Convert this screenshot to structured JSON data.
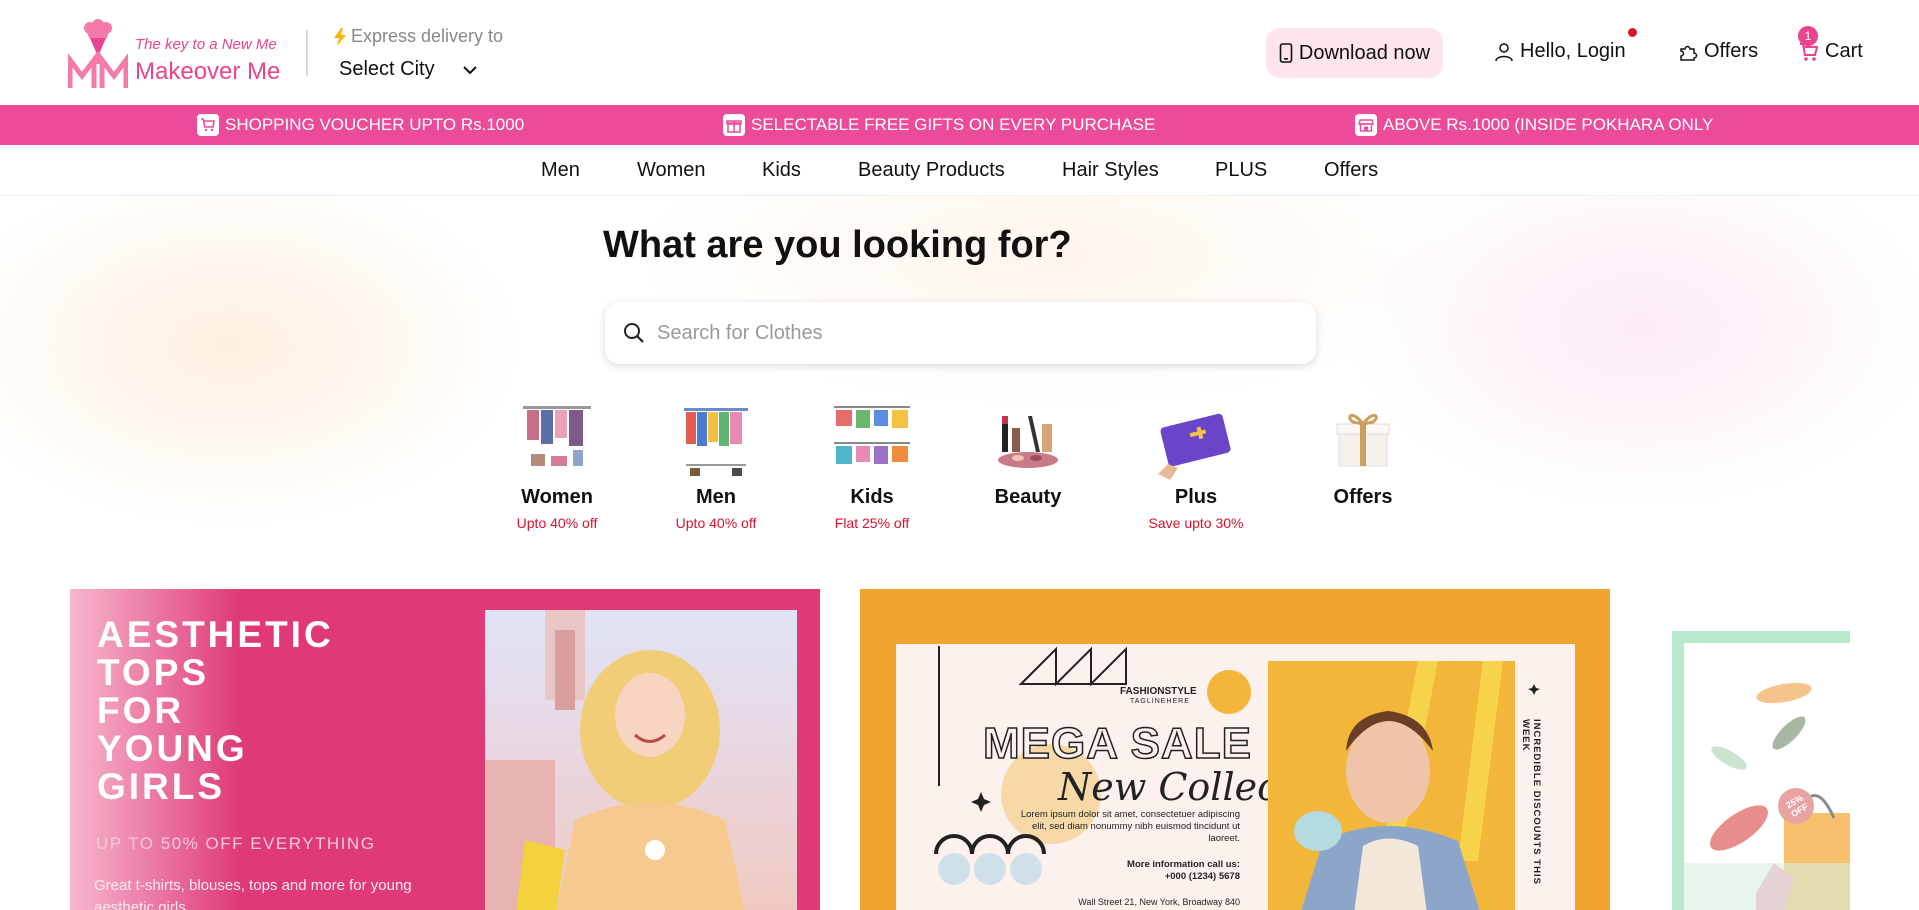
{
  "header": {
    "tagline": "The key to a New Me",
    "brand": "Makeover Me",
    "express_label": "Express delivery to",
    "city_select": "Select City",
    "download_label": "Download now",
    "login_label": "Hello, Login",
    "offers_label": "Offers",
    "cart_label": "Cart",
    "cart_count": "1"
  },
  "promo": {
    "items": [
      "SHOPPING VOUCHER UPTO Rs.1000",
      "SELECTABLE FREE GIFTS ON EVERY PURCHASE",
      "ABOVE Rs.1000 (INSIDE POKHARA ONLY"
    ]
  },
  "nav": {
    "items": [
      "Men",
      "Women",
      "Kids",
      "Beauty Products",
      "Hair Styles",
      "PLUS",
      "Offers"
    ]
  },
  "hero": {
    "title": "What are you looking for?",
    "search_placeholder": "Search for Clothes"
  },
  "categories": [
    {
      "label": "Women",
      "sub": "Upto 40% off"
    },
    {
      "label": "Men",
      "sub": "Upto 40% off"
    },
    {
      "label": "Kids",
      "sub": "Flat 25% off"
    },
    {
      "label": "Beauty",
      "sub": ""
    },
    {
      "label": "Plus",
      "sub": "Save upto 30%"
    },
    {
      "label": "Offers",
      "sub": ""
    }
  ],
  "banner1": {
    "title": "AESTHETIC\nTOPS\nFOR\nYOUNG\nGIRLS",
    "subtitle": "UP TO 50% OFF EVERYTHING",
    "description": "Great t-shirts, blouses, tops and more for young aesthetic girls"
  },
  "banner2": {
    "fashion_style": "FASHIONSTYLE",
    "tagline": "TAGLINEHERE",
    "mega_sale": "MEGA SALE",
    "new_collection": "New Collection",
    "lorem": "Lorem ipsum dolor sit amet, consectetuer adipiscing elit, sed diam nonummy nibh euismod tincidunt ut laoreet.",
    "more_info": "More information call us:",
    "phone": "+000 (1234) 5678",
    "address": "Wall Street 21, New York, Broadway 840",
    "vertical_text": "INCREDIBLE DISCOUNTS THIS WEEK"
  },
  "banner3": {
    "badge": "25% OFF"
  },
  "colors": {
    "brand_pink": "#e8458e",
    "promo_bar": "#ec4b9a",
    "banner1_bg": "#df3a76",
    "banner2_bg": "#f0a62e",
    "discount_red": "#d9122e"
  }
}
